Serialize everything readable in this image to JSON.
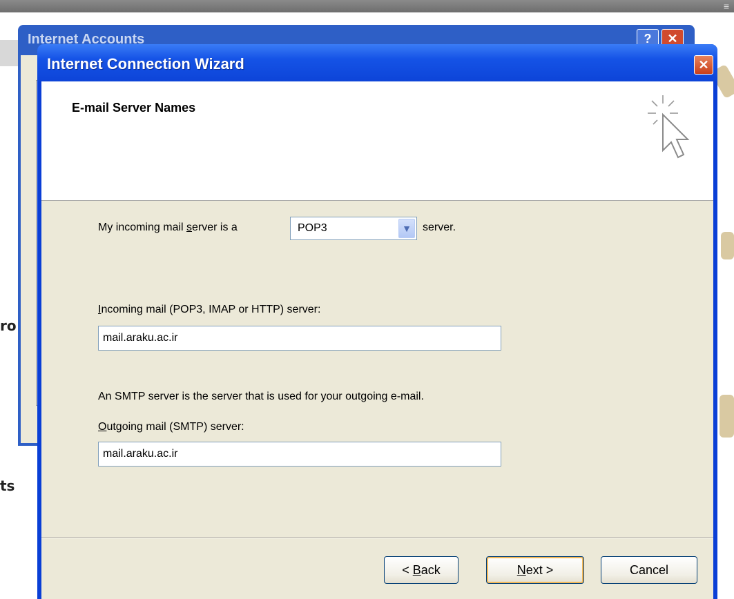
{
  "background_window": {
    "title": "Internet Accounts",
    "help_symbol": "?",
    "close_symbol": "✕",
    "side_label_1": "ro",
    "side_label_2": "ts"
  },
  "wizard": {
    "title": "Internet Connection Wizard",
    "close_symbol": "✕",
    "heading": "E-mail Server Names",
    "incoming_type": {
      "label_prefix_before": "My incoming mail ",
      "label_prefix_accel": "s",
      "label_prefix_after": "erver is a",
      "selected": "POP3",
      "suffix": "server."
    },
    "incoming_server": {
      "label_accel": "I",
      "label_rest": "ncoming mail (POP3, IMAP or HTTP) server:",
      "value": "mail.araku.ac.ir"
    },
    "smtp_note": "An SMTP server is the server that is used for your outgoing e-mail.",
    "outgoing_server": {
      "label_accel": "O",
      "label_rest": "utgoing mail (SMTP) server:",
      "value": "mail.araku.ac.ir"
    },
    "buttons": {
      "back_prefix": "< ",
      "back_accel": "B",
      "back_rest": "ack",
      "next_accel": "N",
      "next_rest": "ext >",
      "cancel": "Cancel"
    }
  }
}
